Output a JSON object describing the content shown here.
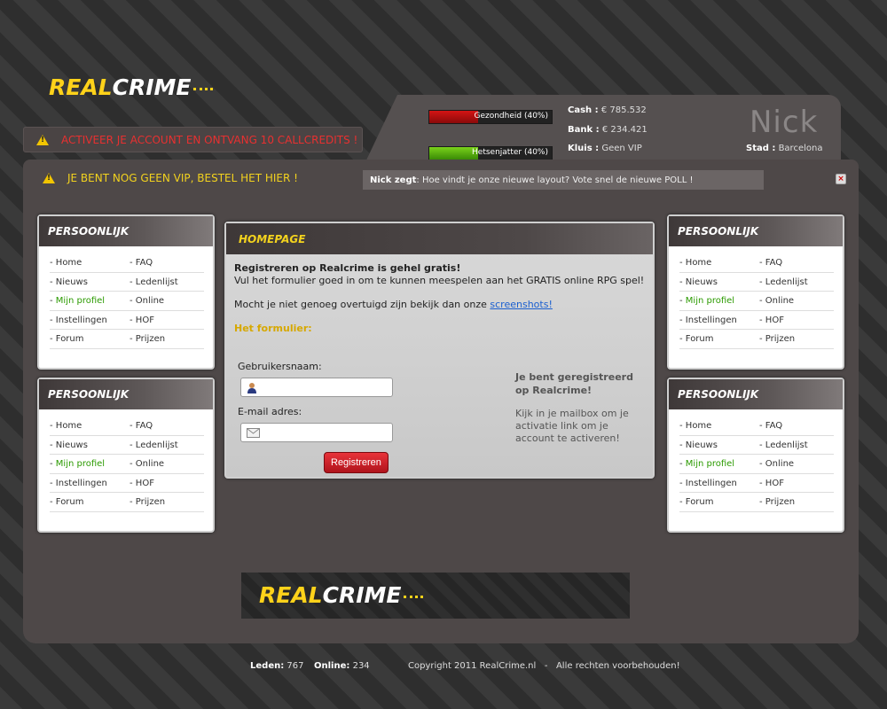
{
  "logo": {
    "real": "REAL",
    "crime": "CRIME"
  },
  "alerts": {
    "account": "ACTIVEER JE ACCOUNT EN ONTVANG 10 CALLCREDITS !",
    "vip": "JE BENT NOG GEEN VIP, BESTEL HET HIER !"
  },
  "header": {
    "health": {
      "label": "Gezondheid (40%)",
      "value": 40,
      "color": "#d41414"
    },
    "energy": {
      "label": "Hetsenjatter (40%)",
      "value": 40,
      "color": "#7ad21a"
    },
    "cash_label": "Cash :",
    "cash_value": "€ 785.532",
    "bank_label": "Bank :",
    "bank_value": "€ 234.421",
    "club_label": "Kluis :",
    "club_value": "Geen VIP",
    "user": "Nick",
    "city_label": "Stad :",
    "city_value": "Barcelona"
  },
  "message": {
    "author": "Nick zegt",
    "text": " : Hoe vindt je onze nieuwe layout? Vote snel de nieuwe POLL !"
  },
  "menu": {
    "title": "PERSOONLIJK",
    "items": [
      "Home",
      "FAQ",
      "Nieuws",
      "Ledenlijst",
      "Mijn profiel",
      "Online",
      "Instellingen",
      "HOF",
      "Forum",
      "Prijzen"
    ]
  },
  "homepage": {
    "title": "HOMEPAGE",
    "heading": "Registreren op Realcrime is gehel gratis!",
    "line1": "Vul het formulier goed in om te kunnen meespelen aan het GRATIS online RPG spel!",
    "line2": "Mocht je niet genoeg overtuigd zijn bekijk dan onze",
    "link": "screenshots!",
    "form_title": "Het formulier:",
    "username_label": "Gebruikersnaam:",
    "email_label": "E-mail adres:",
    "register_button": "Registreren",
    "success_title": "Je bent geregistreerd op Realcrime!",
    "success_text": "Kijk in je mailbox om je activatie link om je account te activeren!"
  },
  "footer": {
    "members_label": "Leden:",
    "members_value": "767",
    "online_label": "Online:",
    "online_value": "234",
    "copyright": "Copyright 2011 RealCrime.nl   -   Alle rechten voorbehouden!"
  }
}
